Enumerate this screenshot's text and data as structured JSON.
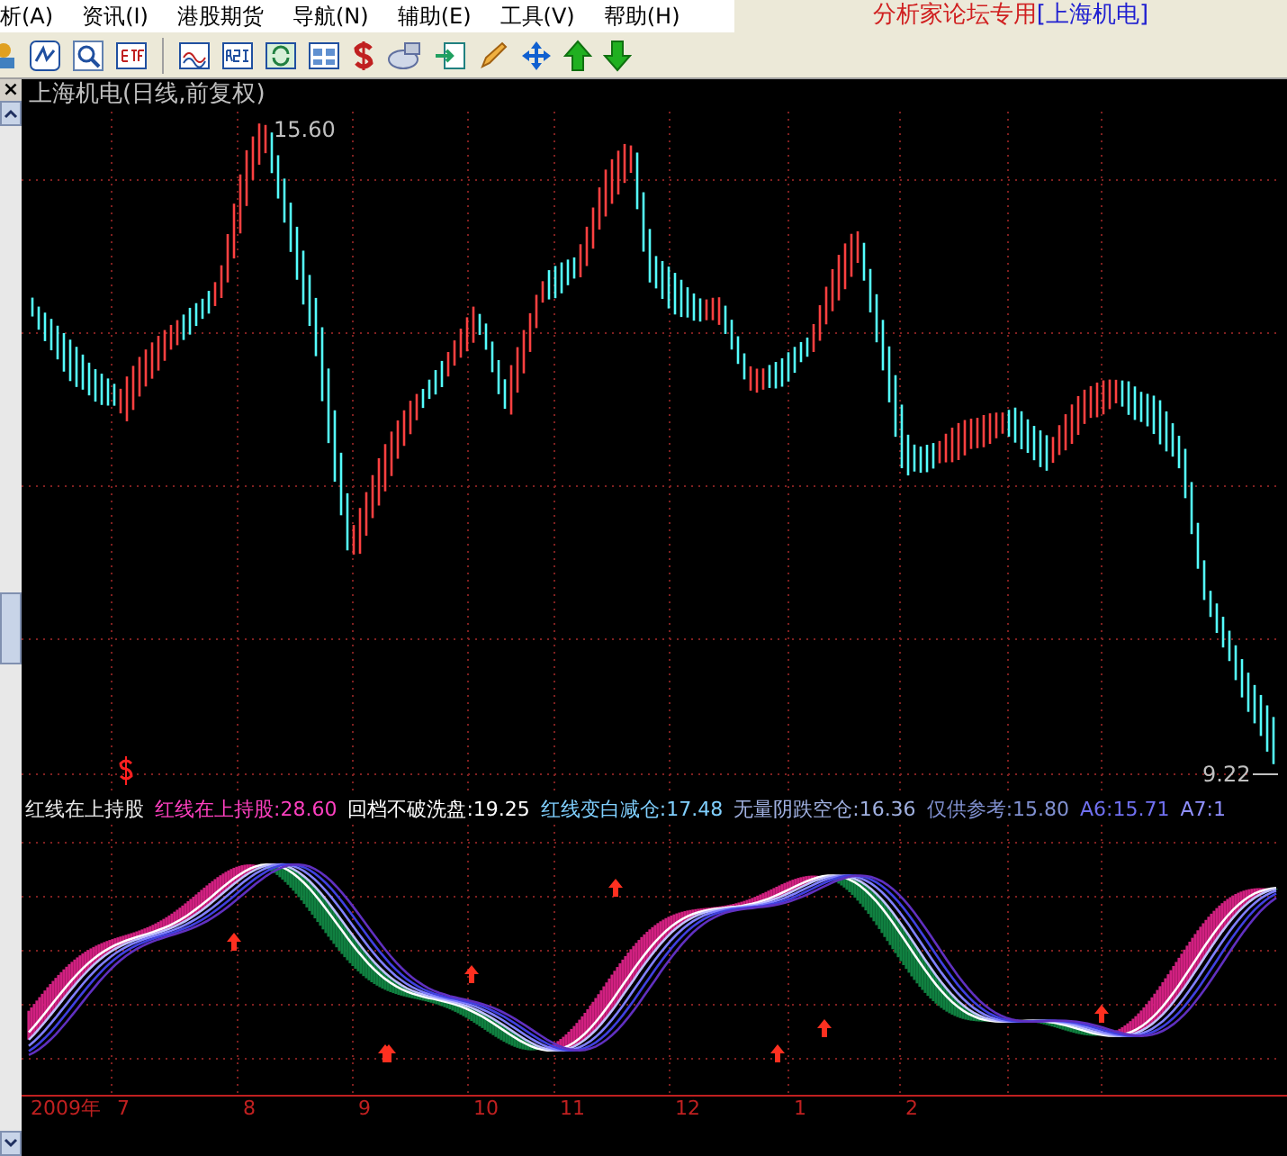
{
  "menu": [
    {
      "label": "析(A)"
    },
    {
      "label": "资讯(I)"
    },
    {
      "label": "港股期货"
    },
    {
      "label": "导航(N)"
    },
    {
      "label": "辅助(E)"
    },
    {
      "label": "工具(V)"
    },
    {
      "label": "帮助(H)"
    }
  ],
  "banner": {
    "text": "分析家论坛专用",
    "stock": "[上海机电]"
  },
  "close_button": "×",
  "chart": {
    "title": "上海机电(日线,前复权)",
    "high_label": "15.60",
    "low_label": "9.22"
  },
  "legend": [
    {
      "text": "红线在上持股",
      "color": "#e8e8e8"
    },
    {
      "text": "红线在上持股:28.60",
      "color": "#ff40c0"
    },
    {
      "text": "回档不破洗盘:19.25",
      "color": "#ffffff"
    },
    {
      "text": "红线变白减仓:17.48",
      "color": "#80d0ff"
    },
    {
      "text": "无量阴跌空仓:16.36",
      "color": "#a0b0e0"
    },
    {
      "text": "仅供参考:15.80",
      "color": "#8090d0"
    },
    {
      "text": "A6:15.71",
      "color": "#7070f0"
    },
    {
      "text": "A7:1",
      "color": "#9090ff"
    }
  ],
  "axis": [
    {
      "label": "2009年"
    },
    {
      "label": "7"
    },
    {
      "label": "8"
    },
    {
      "label": "9"
    },
    {
      "label": "10"
    },
    {
      "label": "11"
    },
    {
      "label": "12"
    },
    {
      "label": "1"
    },
    {
      "label": "2"
    }
  ]
}
